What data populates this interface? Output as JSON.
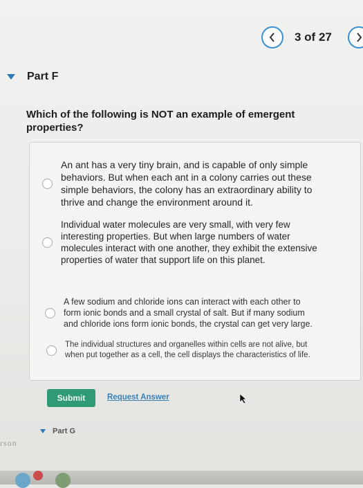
{
  "pager": {
    "prev_icon": "chevron-left-icon",
    "position_text": "3 of 27",
    "next_icon": "chevron-right-icon"
  },
  "part_f": {
    "title": "Part F",
    "question": "Which of the following is NOT an example of emergent properties?",
    "options": [
      {
        "label": "An ant has a very tiny brain, and is capable of only simple behaviors. But when each ant in a colony carries out these simple behaviors, the colony has an extraordinary ability to thrive and change the environment around it."
      },
      {
        "label": "Individual water molecules are very small, with very few interesting properties. But when large numbers of water molecules interact with one another, they exhibit the extensive properties of water that support life on this planet."
      },
      {
        "label": "A few sodium and chloride ions can interact with each other to form ionic bonds and a small crystal of salt. But if many sodium and chloride ions form ionic bonds, the crystal can get very large."
      },
      {
        "label": "The individual structures and organelles within cells are not alive, but when put together as a cell, the cell displays the characteristics of life."
      }
    ],
    "submit_label": "Submit",
    "request_answer_label": "Request Answer"
  },
  "part_g": {
    "title": "Part G"
  },
  "brand_fragment": "rson",
  "colors": {
    "accent": "#3a8fd0",
    "submit": "#2f9a73",
    "link": "#3b7fb7"
  }
}
